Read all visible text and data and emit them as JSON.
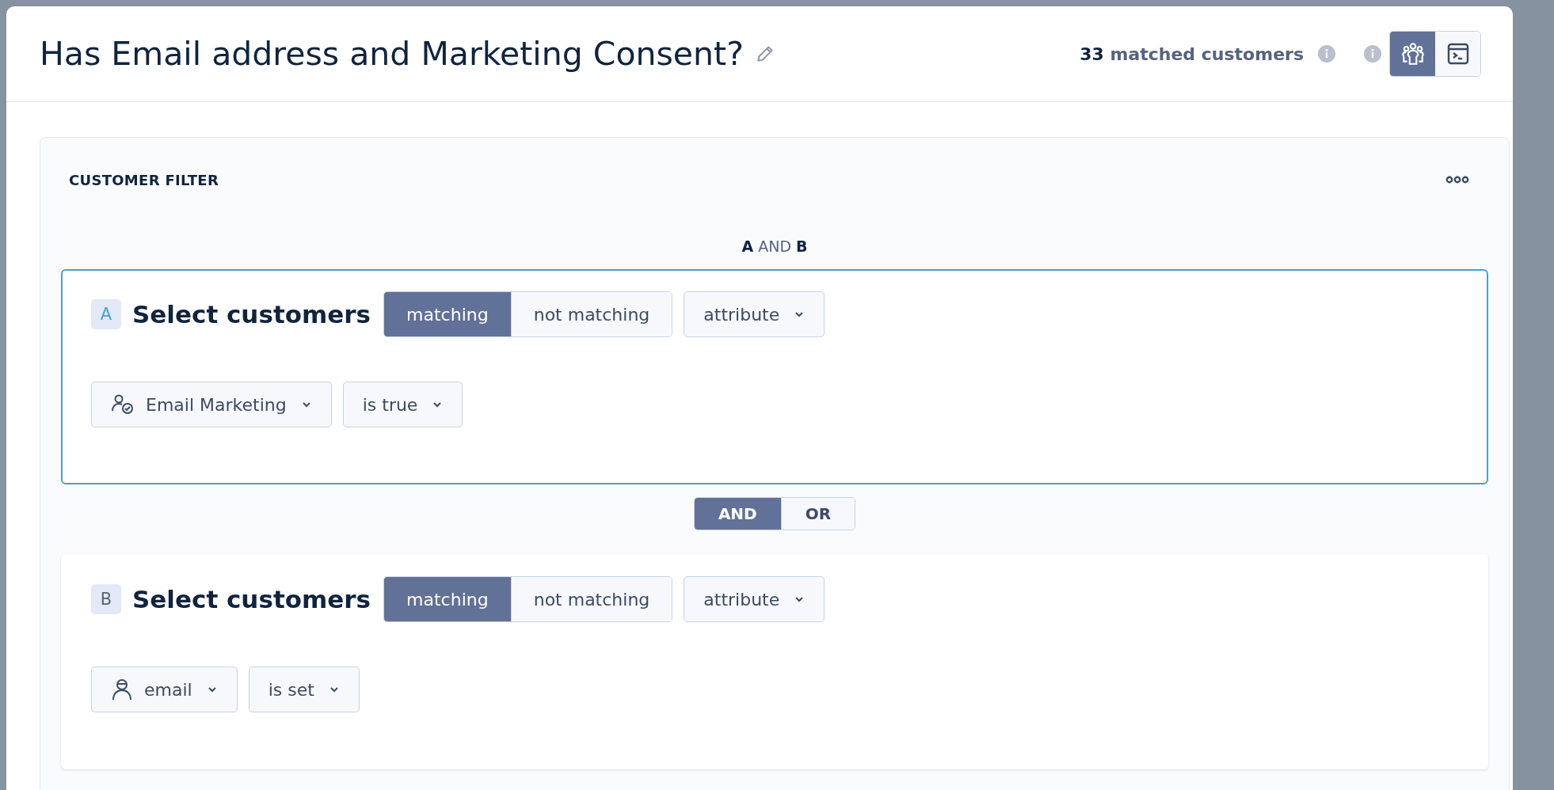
{
  "header": {
    "title": "Has Email address and Marketing Consent?",
    "matched_count": "33",
    "matched_label": "matched customers",
    "view_toggle": [
      {
        "kind": "people",
        "selected": true
      },
      {
        "kind": "terminal",
        "selected": false
      }
    ]
  },
  "filter": {
    "title": "CUSTOMER FILTER",
    "logic": "**A** AND **B**",
    "groups": [
      {
        "letter": "A",
        "focused": true,
        "title": "Select customers",
        "match_options": [
          {
            "label": "matching",
            "selected": true
          },
          {
            "label": "not matching",
            "selected": false
          }
        ],
        "type": "attribute",
        "conditions": [
          {
            "kind": "consent",
            "field": "Email Marketing",
            "operator": "is true"
          }
        ]
      },
      {
        "letter": "B",
        "focused": false,
        "title": "Select customers",
        "match_options": [
          {
            "label": "matching",
            "selected": true
          },
          {
            "label": "not matching",
            "selected": false
          }
        ],
        "type": "attribute",
        "conditions": [
          {
            "kind": "profile",
            "field": "email",
            "operator": "is set"
          }
        ]
      }
    ],
    "joiner": [
      {
        "label": "AND",
        "selected": true
      },
      {
        "label": "OR",
        "selected": false
      }
    ]
  }
}
